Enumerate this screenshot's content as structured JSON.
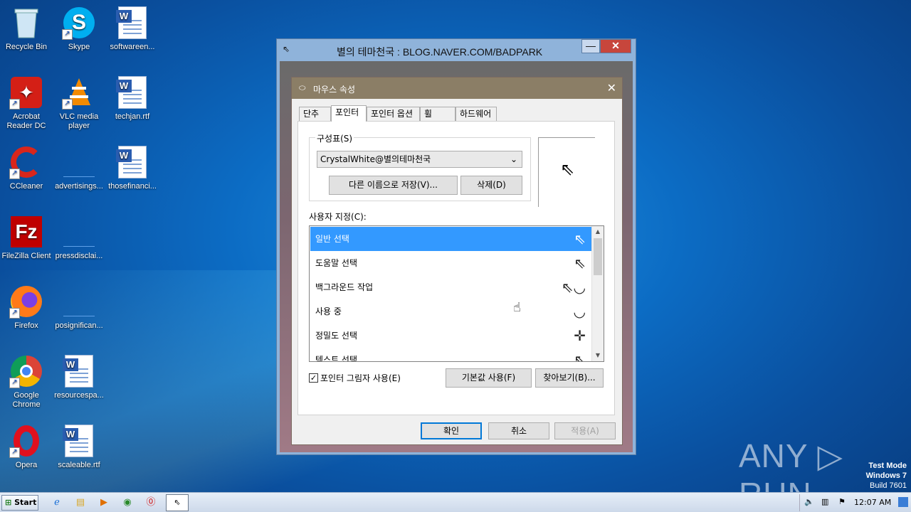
{
  "desktop": {
    "icons": [
      {
        "label": "Recycle Bin",
        "icon": "recycle-bin-icon"
      },
      {
        "label": "Skype",
        "icon": "skype-icon"
      },
      {
        "label": "softwareen...",
        "icon": "word-doc-icon"
      },
      {
        "label": "Acrobat Reader DC",
        "icon": "acrobat-icon"
      },
      {
        "label": "VLC media player",
        "icon": "vlc-icon"
      },
      {
        "label": "techjan.rtf",
        "icon": "word-doc-icon"
      },
      {
        "label": "CCleaner",
        "icon": "ccleaner-icon"
      },
      {
        "label": "advertisings...",
        "icon": "blank-file-icon"
      },
      {
        "label": "thosefinanci...",
        "icon": "word-doc-icon"
      },
      {
        "label": "FileZilla Client",
        "icon": "filezilla-icon"
      },
      {
        "label": "pressdisclai...",
        "icon": "blank-file-icon"
      },
      {
        "label": "Firefox",
        "icon": "firefox-icon"
      },
      {
        "label": "posignifican...",
        "icon": "blank-file-icon"
      },
      {
        "label": "Google Chrome",
        "icon": "chrome-icon"
      },
      {
        "label": "resourcespa...",
        "icon": "word-doc-icon"
      },
      {
        "label": "Opera",
        "icon": "opera-icon"
      },
      {
        "label": "scaleable.rtf",
        "icon": "word-doc-icon"
      }
    ]
  },
  "outer_window": {
    "title": "별의 테마천국 : BLOG.NAVER.COM/BADPARK",
    "minimize": "—",
    "close": "✕"
  },
  "dialog": {
    "title": "마우스 속성",
    "close": "✕",
    "tabs": [
      "단추",
      "포인터",
      "포인터 옵션",
      "휠",
      "하드웨어"
    ],
    "active_tab": "포인터",
    "scheme": {
      "label": "구성표(S)",
      "selected": "CrystalWhite@별의테마천국",
      "save_as": "다른 이름으로 저장(V)...",
      "delete": "삭제(D)"
    },
    "customize_label": "사용자 지정(C):",
    "cursors": [
      {
        "name": "일반 선택",
        "glyph": "⇖",
        "selected": true
      },
      {
        "name": "도움말 선택",
        "glyph": "⇖"
      },
      {
        "name": "백그라운드 작업",
        "glyph": "⇖◡"
      },
      {
        "name": "사용 중",
        "glyph": "◡"
      },
      {
        "name": "정밀도 선택",
        "glyph": "✛"
      },
      {
        "name": "텍스트 선택",
        "glyph": "⇖"
      }
    ],
    "shadow_checkbox": {
      "label": "포인터 그림자 사용(E)",
      "checked": true
    },
    "use_default": "기본값 사용(F)",
    "browse": "찾아보기(B)...",
    "ok": "확인",
    "cancel": "취소",
    "apply": "적용(A)"
  },
  "taskbar": {
    "start": "Start",
    "clock": "12:07 AM"
  },
  "watermark": "ANY ▷ RUN",
  "test_mode": {
    "line1": "Test Mode",
    "line2": "Windows 7",
    "line3": "Build 7601"
  }
}
